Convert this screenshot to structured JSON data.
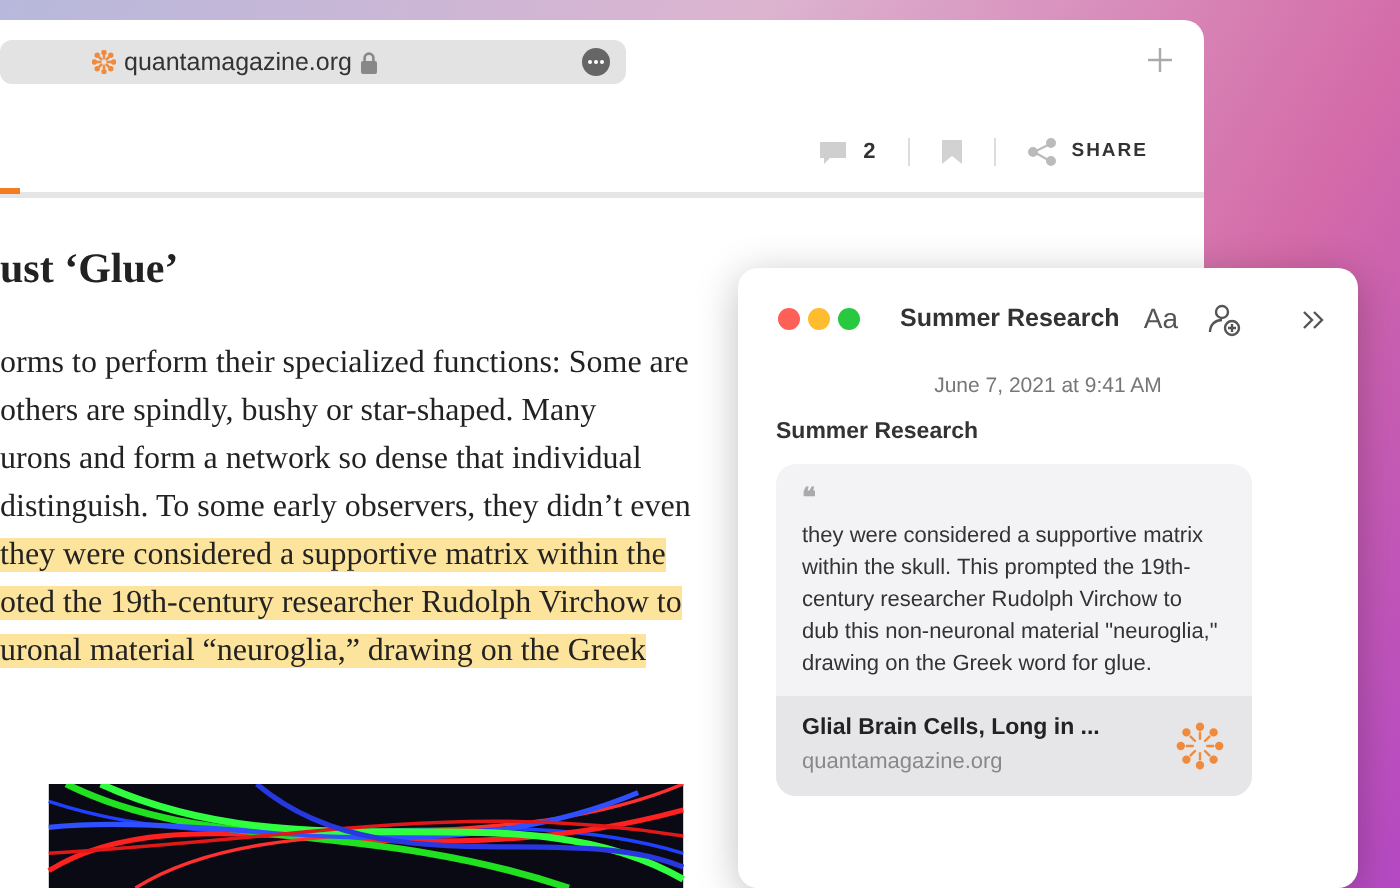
{
  "browser": {
    "address": "quantamagazine.org",
    "comment_count": "2",
    "share_label": "SHARE"
  },
  "article": {
    "heading": "ust ‘Glue’",
    "lines": [
      {
        "text": "orms to perform their specialized functions: Some are",
        "highlighted": false
      },
      {
        "text": "others are spindly, bushy or star-shaped. Many",
        "highlighted": false
      },
      {
        "text": "urons and form a network so dense that individual",
        "highlighted": false
      },
      {
        "text": "distinguish. To some early observers, they didn’t even",
        "highlighted": false
      },
      {
        "text": "they were considered a supportive matrix within the",
        "highlighted": true
      },
      {
        "text": "oted the 19th-century researcher Rudolph Virchow to",
        "highlighted": true
      },
      {
        "text": "uronal material “neuroglia,” drawing on the Greek",
        "highlighted": true
      }
    ]
  },
  "notes": {
    "title": "Summer Research",
    "format_label": "Aa",
    "date": "June 7, 2021 at 9:41 AM",
    "note_title": "Summer Research",
    "quote": {
      "mark": "❝",
      "text": "they were considered a supportive matrix within the skull. This prompted the 19th-century researcher Rudolph Virchow to dub this non-neuronal material \"neuroglia,\" drawing on the Greek word for glue.",
      "link_title": "Glial Brain Cells, Long in ...",
      "link_domain": "quantamagazine.org"
    }
  }
}
